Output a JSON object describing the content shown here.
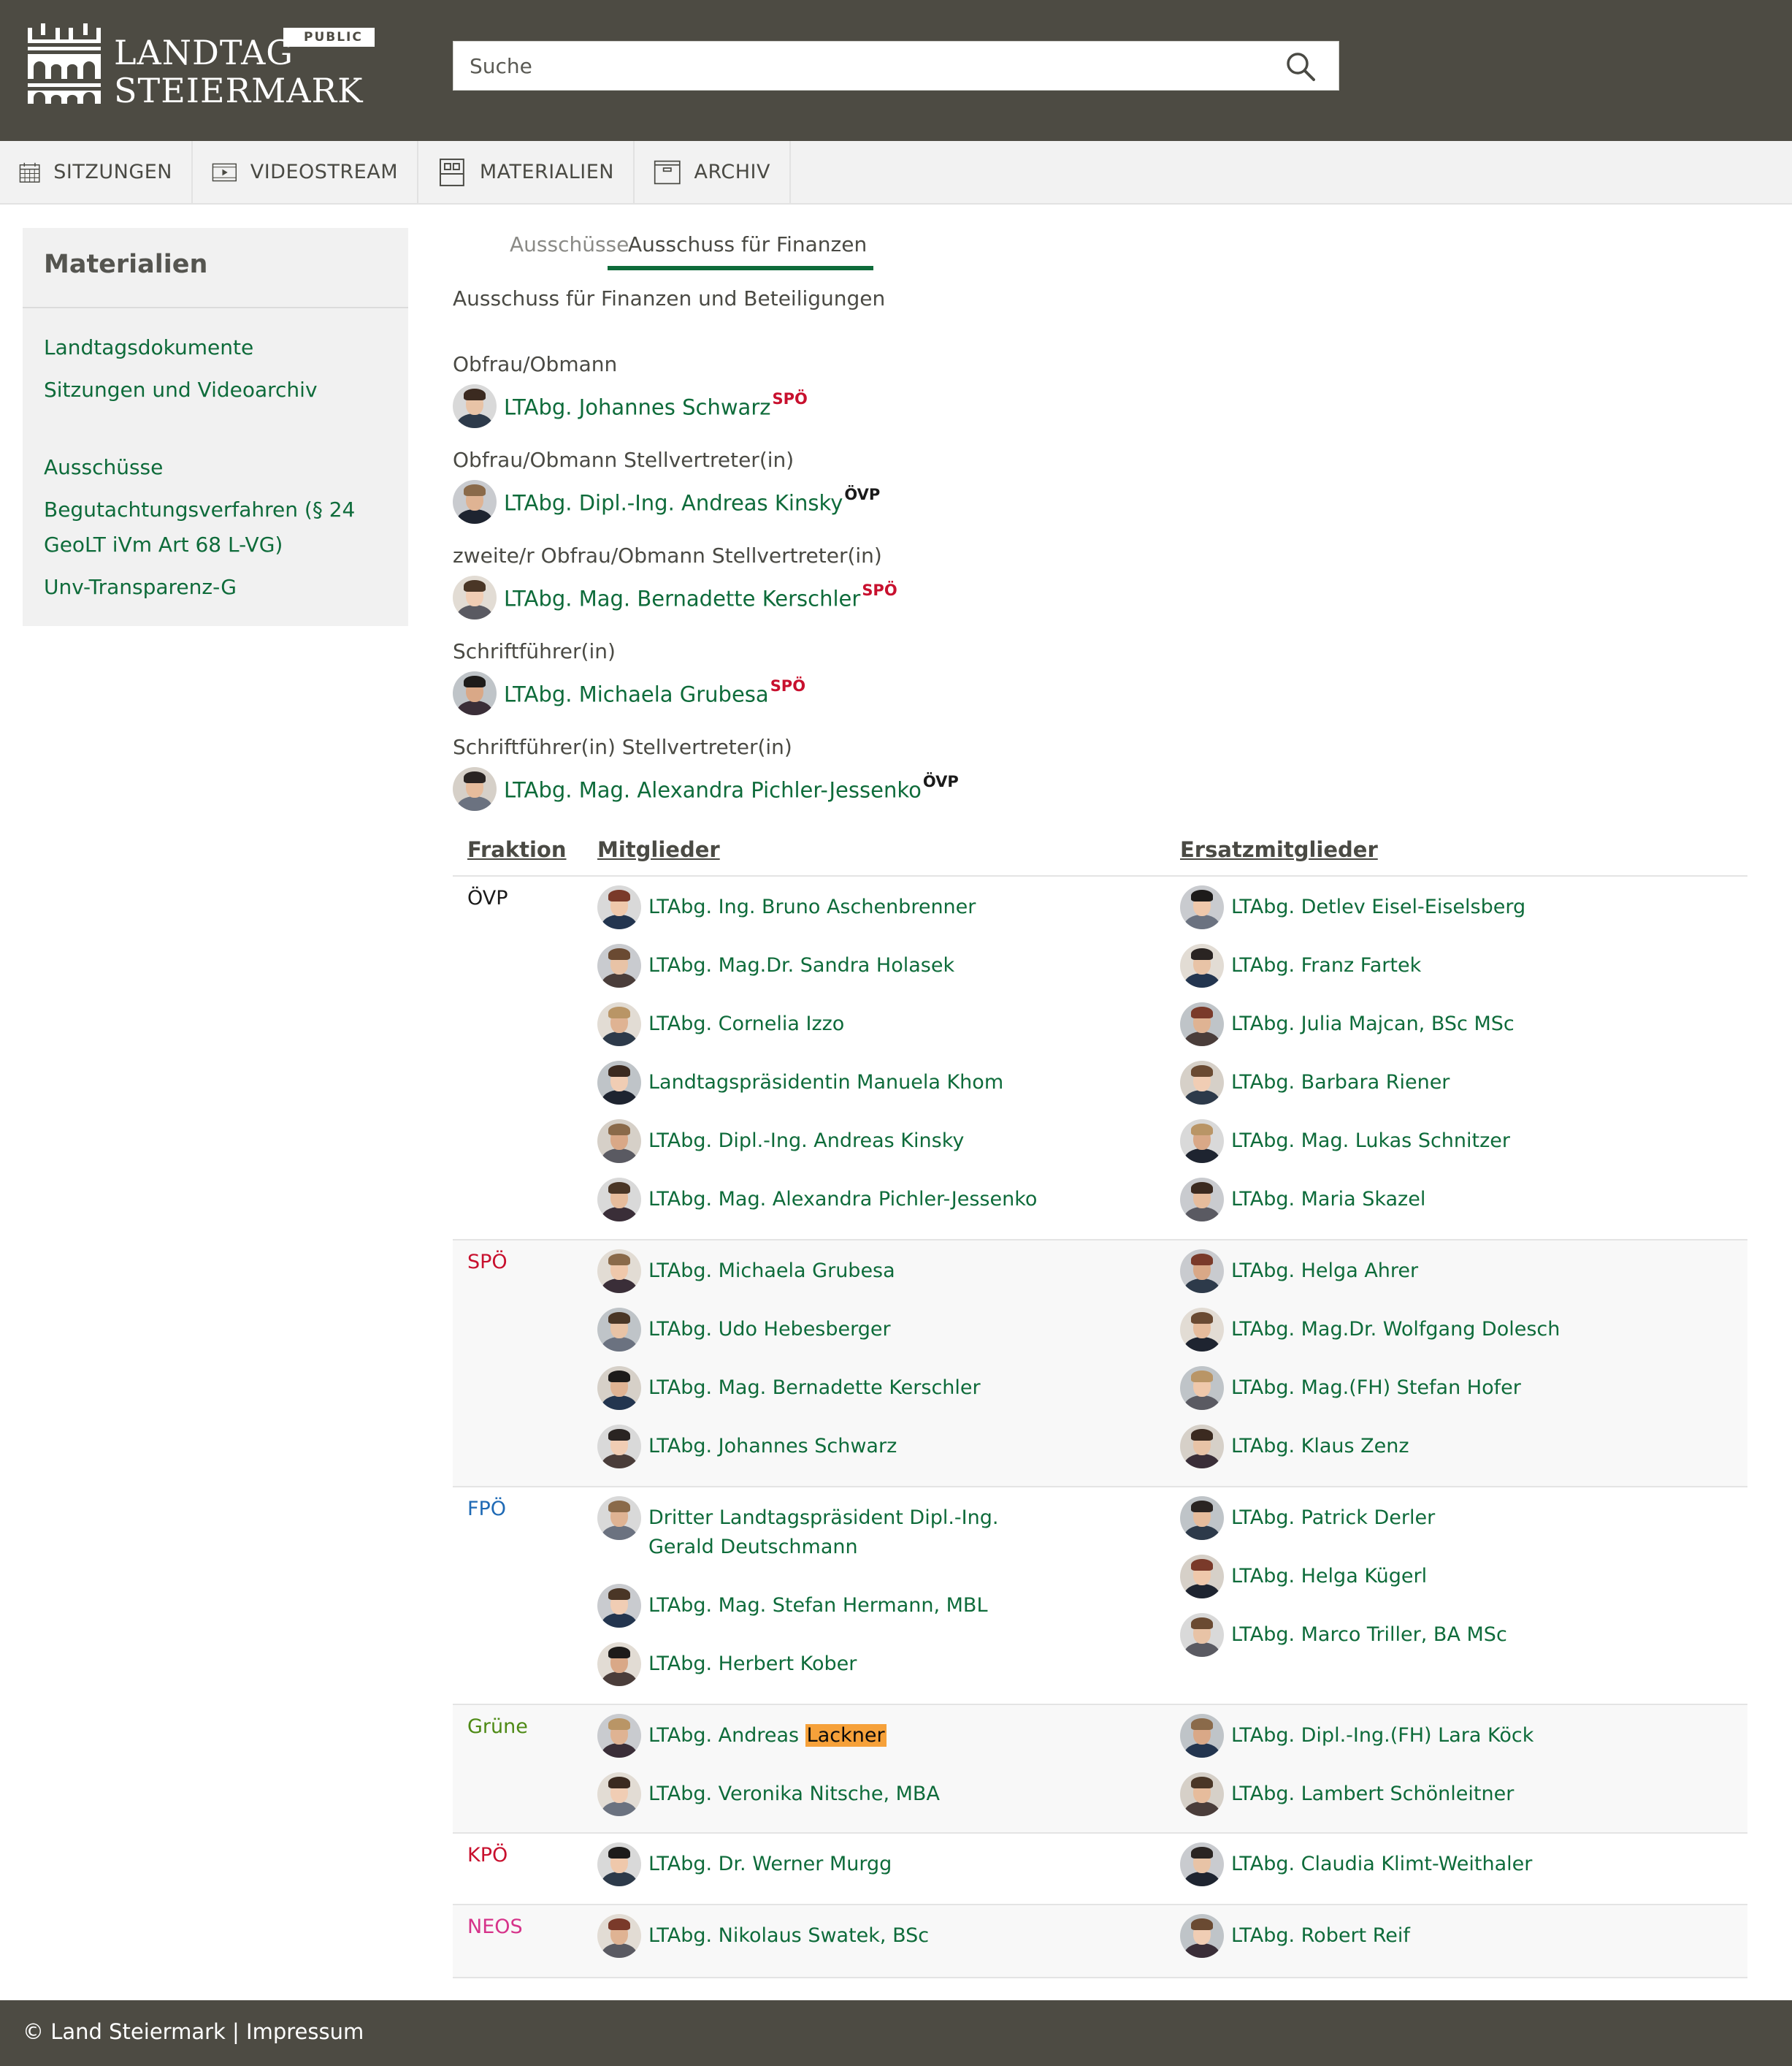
{
  "header": {
    "logo_line1": "LANDTAG",
    "logo_line2": "STEIERMARK",
    "badge": "PUBLIC",
    "search_placeholder": "Suche"
  },
  "nav": [
    {
      "label": "SITZUNGEN",
      "icon": "calendar-icon"
    },
    {
      "label": "VIDEOSTREAM",
      "icon": "video-icon"
    },
    {
      "label": "MATERIALIEN",
      "icon": "documents-icon"
    },
    {
      "label": "ARCHIV",
      "icon": "archive-box-icon"
    }
  ],
  "sidebar": {
    "title": "Materialien",
    "links": [
      "Landtagsdokumente",
      "Sitzungen und Videoarchiv",
      "Ausschüsse",
      "Begutachtungsverfahren (§ 24",
      "GeoLT iVm Art 68 L-VG)",
      "Unv-Transparenz-G"
    ]
  },
  "tabs": {
    "inactive": "Ausschüsse",
    "active": "Ausschuss für Finanzen"
  },
  "committee_full_name": "Ausschuss für Finanzen und Beteiligungen",
  "colors": {
    "OVP": "#1a1a1a",
    "SPO": "#c8102e",
    "FPO": "#1f6ab5",
    "GRUENE": "#4e8a16",
    "KPO": "#c8102e",
    "NEOS": "#d6338a",
    "link": "#0e6b3a"
  },
  "roles": [
    {
      "label": "Obfrau/Obmann",
      "name": "LTAbg. Johannes Schwarz",
      "party": "SPÖ",
      "party_key": "SPO"
    },
    {
      "label": "Obfrau/Obmann Stellvertreter(in)",
      "name": "LTAbg. Dipl.-Ing. Andreas Kinsky",
      "party": "ÖVP",
      "party_key": "OVP"
    },
    {
      "label": "zweite/r Obfrau/Obmann Stellvertreter(in)",
      "name": "LTAbg. Mag. Bernadette Kerschler",
      "party": "SPÖ",
      "party_key": "SPO"
    },
    {
      "label": "Schriftführer(in)",
      "name": "LTAbg. Michaela Grubesa",
      "party": "SPÖ",
      "party_key": "SPO"
    },
    {
      "label": "Schriftführer(in) Stellvertreter(in)",
      "name": "LTAbg. Mag. Alexandra Pichler-Jessenko",
      "party": "ÖVP",
      "party_key": "OVP"
    }
  ],
  "table": {
    "headers": {
      "fraktion": "Fraktion",
      "mitglieder": "Mitglieder",
      "ersatz": "Ersatzmitglieder"
    },
    "groups": [
      {
        "fraktion": "ÖVP",
        "party_key": "OVP",
        "members": [
          "LTAbg. Ing. Bruno Aschenbrenner",
          "LTAbg. Mag.Dr. Sandra Holasek",
          "LTAbg. Cornelia Izzo",
          "Landtagspräsidentin Manuela Khom",
          "LTAbg. Dipl.-Ing. Andreas Kinsky",
          "LTAbg. Mag. Alexandra Pichler-Jessenko"
        ],
        "substitutes": [
          "LTAbg. Detlev Eisel-Eiselsberg",
          "LTAbg. Franz Fartek",
          "LTAbg. Julia Majcan, BSc MSc",
          "LTAbg. Barbara Riener",
          "LTAbg. Mag. Lukas Schnitzer",
          "LTAbg. Maria Skazel"
        ]
      },
      {
        "fraktion": "SPÖ",
        "party_key": "SPO",
        "members": [
          "LTAbg. Michaela Grubesa",
          "LTAbg. Udo Hebesberger",
          "LTAbg. Mag. Bernadette Kerschler",
          "LTAbg. Johannes Schwarz"
        ],
        "substitutes": [
          "LTAbg. Helga Ahrer",
          "LTAbg. Mag.Dr. Wolfgang Dolesch",
          "LTAbg. Mag.(FH) Stefan Hofer",
          "LTAbg. Klaus Zenz"
        ]
      },
      {
        "fraktion": "FPÖ",
        "party_key": "FPO",
        "members": [
          "Dritter Landtagspräsident Dipl.-Ing. Gerald Deutschmann",
          "LTAbg. Mag. Stefan Hermann, MBL",
          "LTAbg. Herbert Kober"
        ],
        "substitutes": [
          "LTAbg. Patrick Derler",
          "LTAbg. Helga Kügerl",
          "LTAbg. Marco Triller, BA MSc"
        ]
      },
      {
        "fraktion": "Grüne",
        "party_key": "GRUENE",
        "members": [
          "LTAbg. Andreas Lackner",
          "LTAbg. Veronika Nitsche, MBA"
        ],
        "substitutes": [
          "LTAbg. Dipl.-Ing.(FH) Lara Köck",
          "LTAbg. Lambert Schönleitner"
        ]
      },
      {
        "fraktion": "KPÖ",
        "party_key": "KPO",
        "members": [
          "LTAbg. Dr. Werner Murgg"
        ],
        "substitutes": [
          "LTAbg. Claudia Klimt-Weithaler"
        ]
      },
      {
        "fraktion": "NEOS",
        "party_key": "NEOS",
        "members": [
          "LTAbg. Nikolaus Swatek, BSc"
        ],
        "substitutes": [
          "LTAbg. Robert Reif"
        ]
      }
    ]
  },
  "footer": {
    "copyright": "© Land Steiermark",
    "separator": "|",
    "impressum": "Impressum"
  }
}
